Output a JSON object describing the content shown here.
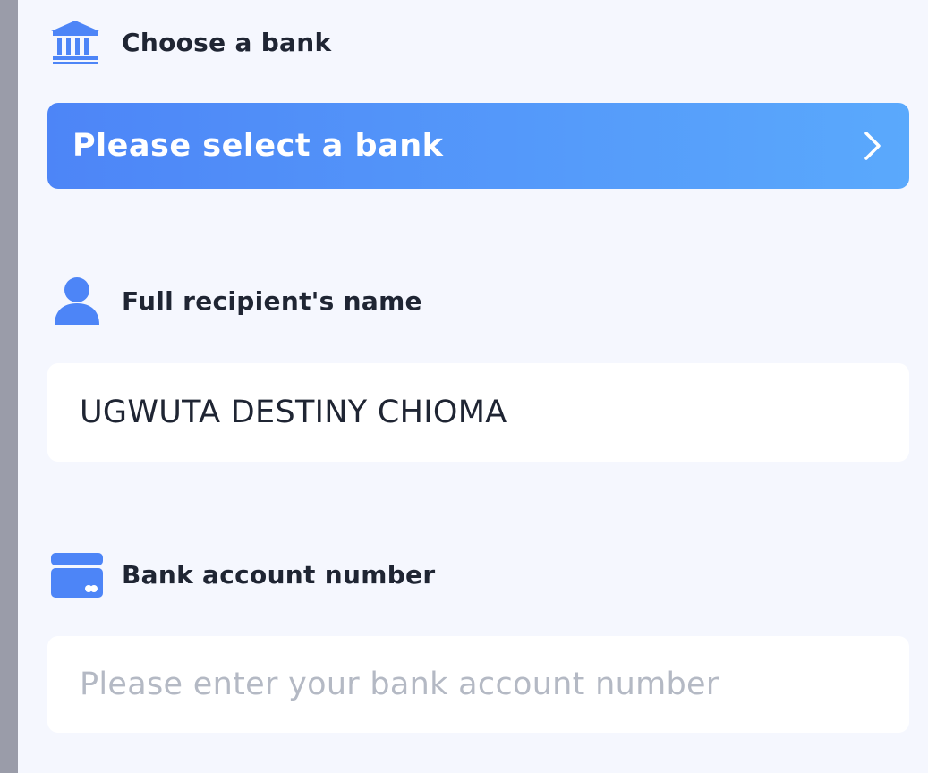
{
  "colors": {
    "accent": "#4d85f7",
    "accent_end": "#5aa9fc",
    "background": "#f5f7fe",
    "text": "#1f2533",
    "placeholder": "#b4b9c4"
  },
  "bank_section": {
    "icon": "bank-icon",
    "label": "Choose a bank",
    "select_text": "Please select a bank",
    "chevron_icon": "chevron-right-icon"
  },
  "name_section": {
    "icon": "user-icon",
    "label": "Full recipient's name",
    "value": "UGWUTA DESTINY CHIOMA"
  },
  "account_section": {
    "icon": "card-icon",
    "label": "Bank account number",
    "value": "",
    "placeholder": "Please enter your bank account number"
  }
}
